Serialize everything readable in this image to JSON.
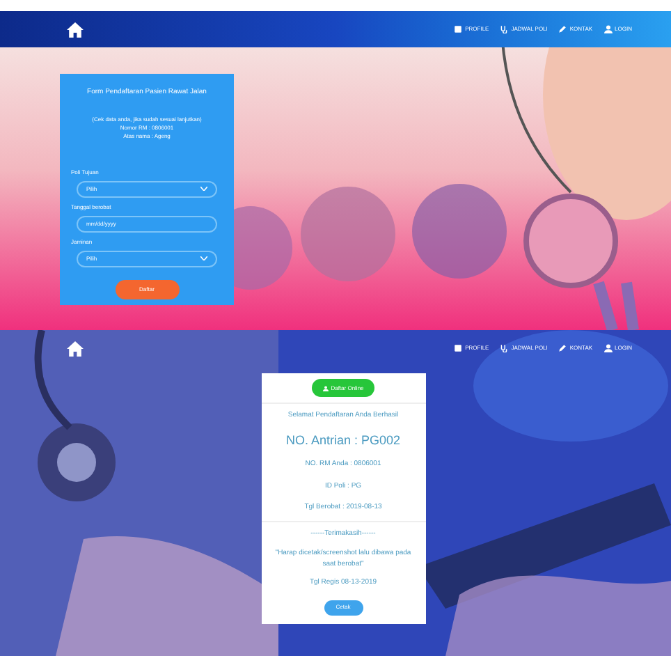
{
  "screens": [
    {
      "nav": {
        "items": [
          {
            "label": "PROFILE"
          },
          {
            "label": "JADWAL POLI"
          },
          {
            "label": "KONTAK"
          },
          {
            "label": "LOGIN"
          }
        ]
      },
      "form": {
        "title": "Form Pendaftaran Pasien Rawat Jalan",
        "note": "(Cek data anda, jika sudah sesuai lanjutkan)",
        "record": "Nomor RM : 0806001",
        "name": "Atas nama : Ageng",
        "fields": [
          {
            "kind": "select",
            "label": "Poli Tujuan",
            "value": "Pilih"
          },
          {
            "kind": "date",
            "label": "Tanggal berobat",
            "placeholder": "mm/dd/yyyy"
          },
          {
            "kind": "select",
            "label": "Jaminan",
            "value": "Pilih"
          }
        ],
        "submit": "Daftar"
      }
    },
    {
      "nav": {
        "items": [
          {
            "label": "PROFILE"
          },
          {
            "label": "JADWAL POLI"
          },
          {
            "label": "KONTAK"
          },
          {
            "label": "LOGIN"
          }
        ]
      },
      "receipt": {
        "top_button": "Daftar Online",
        "success": "Selamat Pendaftaran Anda Berhasil",
        "queue": "NO. Antrian : PG002",
        "record": "NO. RM Anda : 0806001",
        "poli": "ID Poli : PG",
        "date": "Tgl Berobat : 2019-08-13",
        "thanks": "------Terimakasih------",
        "instruction": "\"Harap dicetak/screenshot lalu dibawa pada saat berobat\"",
        "regis": "Tgl Regis 08-13-2019",
        "print": "Cetak"
      }
    }
  ]
}
